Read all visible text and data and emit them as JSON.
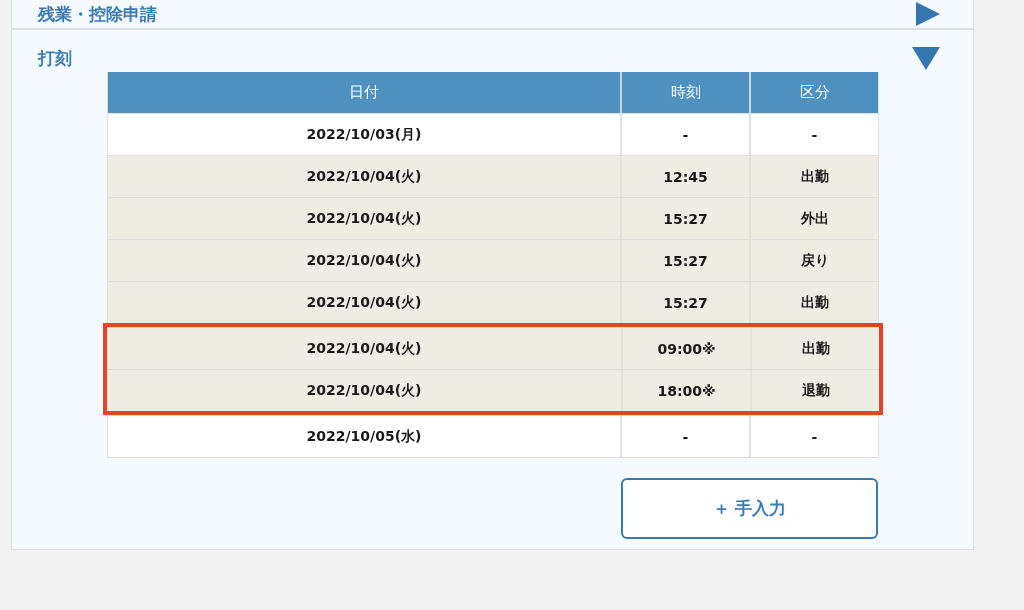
{
  "sections": [
    {
      "title": "残業・控除申請",
      "expanded": false
    },
    {
      "title": "打刻",
      "expanded": true,
      "table": {
        "columns": [
          "日付",
          "時刻",
          "区分"
        ],
        "rows": [
          {
            "cells": [
              "2022/10/03(月)",
              "-",
              "-"
            ],
            "shaded": false,
            "highlighted": false
          },
          {
            "cells": [
              "2022/10/04(火)",
              "12:45",
              "出勤"
            ],
            "shaded": true,
            "highlighted": false
          },
          {
            "cells": [
              "2022/10/04(火)",
              "15:27",
              "外出"
            ],
            "shaded": true,
            "highlighted": false
          },
          {
            "cells": [
              "2022/10/04(火)",
              "15:27",
              "戻り"
            ],
            "shaded": true,
            "highlighted": false
          },
          {
            "cells": [
              "2022/10/04(火)",
              "15:27",
              "出勤"
            ],
            "shaded": true,
            "highlighted": false
          },
          {
            "cells": [
              "2022/10/04(火)",
              "09:00※",
              "出勤"
            ],
            "shaded": true,
            "highlighted": true
          },
          {
            "cells": [
              "2022/10/04(火)",
              "18:00※",
              "退勤"
            ],
            "shaded": true,
            "highlighted": true
          },
          {
            "cells": [
              "2022/10/05(水)",
              "-",
              "-"
            ],
            "shaded": false,
            "highlighted": false
          }
        ]
      },
      "button": "＋ 手入力"
    }
  ]
}
